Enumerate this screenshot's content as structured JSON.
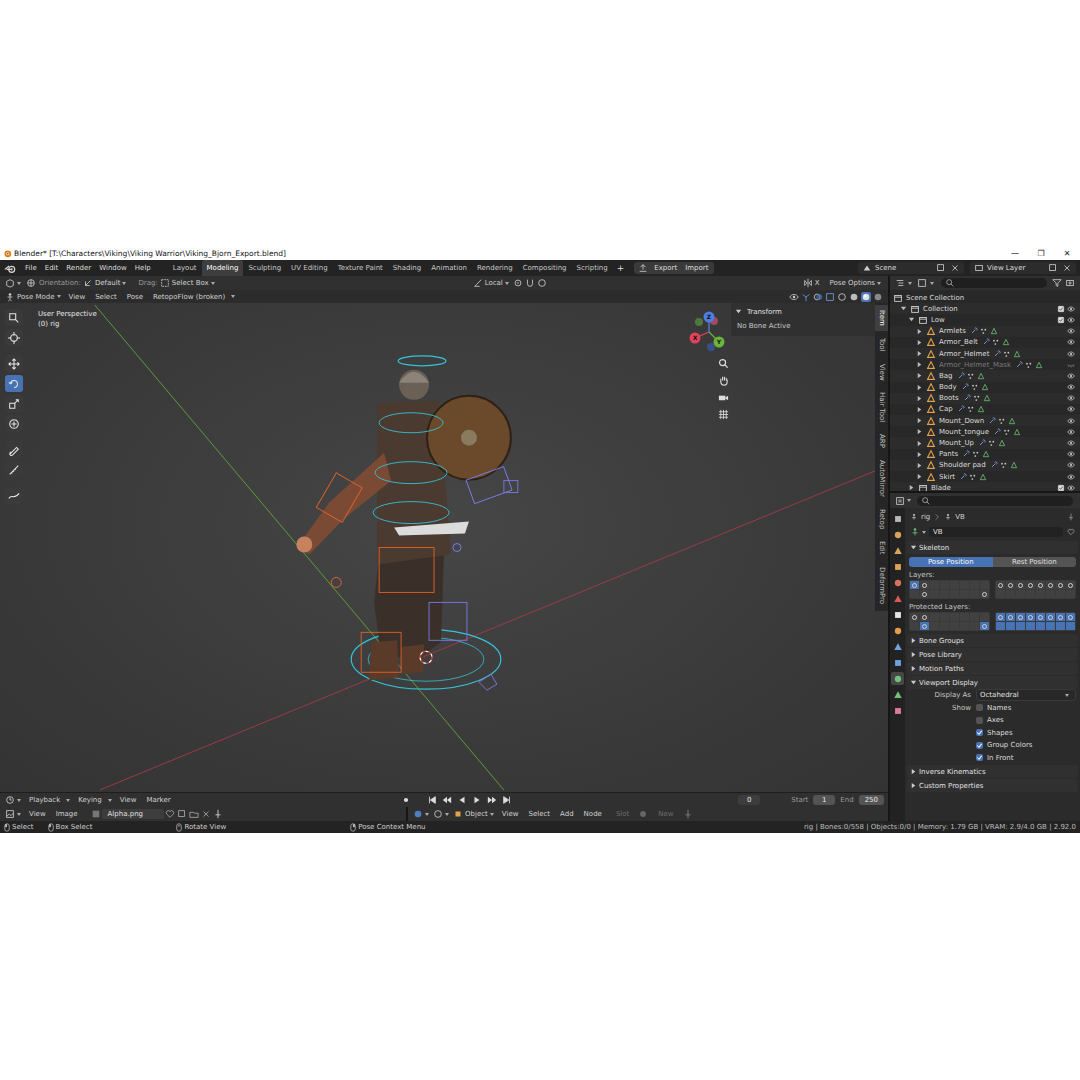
{
  "window": {
    "title": "Blender* [T:\\Characters\\Viking\\Viking Warrior\\Viking_Bjorn_Export.blend]",
    "controls": [
      "—",
      "❐",
      "✕"
    ]
  },
  "menu": [
    "File",
    "Edit",
    "Render",
    "Window",
    "Help"
  ],
  "workspaces": [
    {
      "label": "Layout",
      "selected": false
    },
    {
      "label": "Modeling",
      "selected": true
    },
    {
      "label": "Sculpting",
      "selected": false
    },
    {
      "label": "UV Editing",
      "selected": false
    },
    {
      "label": "Texture Paint",
      "selected": false
    },
    {
      "label": "Shading",
      "selected": false
    },
    {
      "label": "Animation",
      "selected": false
    },
    {
      "label": "Rendering",
      "selected": false
    },
    {
      "label": "Compositing",
      "selected": false
    },
    {
      "label": "Scripting",
      "selected": false
    }
  ],
  "workspace_add": "+",
  "addon_buttons": [
    "Export",
    "Import"
  ],
  "scene": "Scene",
  "view_layer": "View Layer",
  "viewport_header": {
    "orientation_label": "Orientation:",
    "orientation": "Default",
    "drag_label": "Drag:",
    "drag": "Select Box",
    "pivot": "Local",
    "mirror_axis": "X",
    "options": "Pose Options"
  },
  "mode_header": {
    "mode": "Pose Mode",
    "menus": [
      "View",
      "Select",
      "Pose",
      "RetopoFlow (broken)"
    ]
  },
  "viewport": {
    "view_name": "User Perspective",
    "object_name": "(0) rig",
    "gizmo_axes": [
      "X",
      "Y",
      "Z"
    ]
  },
  "tools": [
    {
      "selected": false
    },
    {
      "selected": false
    },
    {
      "selected": false
    },
    {
      "selected": true
    },
    {
      "selected": false
    },
    {
      "selected": false
    },
    {
      "selected": false
    },
    {
      "selected": false
    },
    {
      "selected": false
    }
  ],
  "sidebar": {
    "panel_title": "Transform",
    "message": "No Bone Active",
    "tabs": [
      {
        "label": "Item",
        "selected": true
      },
      {
        "label": "Tool",
        "selected": false
      },
      {
        "label": "View",
        "selected": false
      },
      {
        "label": "Hair Tool",
        "selected": false
      },
      {
        "label": "ARP",
        "selected": false
      },
      {
        "label": "AutoMirror",
        "selected": false
      },
      {
        "label": "Retop",
        "selected": false
      },
      {
        "label": "Edit",
        "selected": false
      },
      {
        "label": "DeformPro",
        "selected": false
      }
    ]
  },
  "timeline": {
    "menus": [
      "Playback",
      "Keying",
      "View",
      "Marker"
    ],
    "current_frame": "0",
    "start_label": "Start",
    "start": "1",
    "end_label": "End",
    "end": "250"
  },
  "image_editor": {
    "menus": [
      "View",
      "Image"
    ],
    "image": "Alpha.png"
  },
  "node_editor": {
    "object": "Object",
    "menus": [
      "View",
      "Select",
      "Add",
      "Node"
    ],
    "slot": "Slot",
    "new": "New"
  },
  "outliner": {
    "root": "Scene Collection",
    "collection": {
      "label": "Collection",
      "checked": true,
      "visible": true,
      "expanded": true
    },
    "sub_collections": [
      {
        "label": "Low",
        "checked": true,
        "visible": true,
        "expanded": true,
        "objects": [
          {
            "label": "Armlets",
            "visible": true
          },
          {
            "label": "Armor_Belt",
            "visible": true
          },
          {
            "label": "Armor_Helmet",
            "visible": true
          },
          {
            "label": "Armor_Helmet_Mask",
            "visible": false
          },
          {
            "label": "Bag",
            "visible": true
          },
          {
            "label": "Body",
            "visible": true
          },
          {
            "label": "Boots",
            "visible": true
          },
          {
            "label": "Cap",
            "visible": true
          },
          {
            "label": "Mount_Down",
            "visible": true
          },
          {
            "label": "Mount_tongue",
            "visible": true
          },
          {
            "label": "Mount_Up",
            "visible": true
          },
          {
            "label": "Pants",
            "visible": true
          },
          {
            "label": "Shoulder pad",
            "visible": true
          },
          {
            "label": "Skirt",
            "visible": true
          }
        ]
      },
      {
        "label": "Blade",
        "checked": true,
        "visible": true,
        "expanded": false,
        "objects": []
      }
    ]
  },
  "properties": {
    "tabs": [
      {
        "selected": false
      },
      {
        "selected": false
      },
      {
        "selected": false
      },
      {
        "selected": false
      },
      {
        "selected": false
      },
      {
        "selected": false
      },
      {
        "selected": false
      },
      {
        "selected": false
      },
      {
        "selected": false
      },
      {
        "selected": false
      },
      {
        "selected": true
      },
      {
        "selected": false
      },
      {
        "selected": false
      }
    ],
    "breadcrumb": [
      "rig",
      "VB"
    ],
    "datablock": "VB",
    "skeleton": {
      "title": "Skeleton",
      "expanded": true,
      "positions": [
        {
          "label": "Pose Position",
          "selected": true
        },
        {
          "label": "Rest Position",
          "selected": false
        }
      ],
      "layers_label": "Layers:",
      "layers": [
        {
          "on": [
            true,
            false,
            false,
            false,
            false,
            false,
            false,
            false,
            false,
            false,
            false,
            false,
            false,
            false,
            false,
            false
          ],
          "dot": [
            true,
            true,
            false,
            false,
            false,
            false,
            false,
            false,
            false,
            true,
            false,
            false,
            false,
            false,
            false,
            true
          ]
        },
        {
          "on": [
            false,
            false,
            false,
            false,
            false,
            false,
            false,
            false,
            false,
            false,
            false,
            false,
            false,
            false,
            false,
            false
          ],
          "dot": [
            true,
            true,
            true,
            true,
            true,
            true,
            true,
            true,
            false,
            false,
            false,
            false,
            false,
            false,
            false,
            false
          ]
        }
      ],
      "protected_label": "Protected Layers:",
      "protected": [
        {
          "on": [
            false,
            false,
            false,
            false,
            false,
            false,
            false,
            false,
            false,
            true,
            false,
            false,
            false,
            false,
            false,
            true
          ],
          "dot": [
            true,
            true,
            false,
            false,
            false,
            false,
            false,
            false,
            false,
            true,
            false,
            false,
            false,
            false,
            false,
            true
          ]
        },
        {
          "on": [
            true,
            true,
            true,
            true,
            true,
            true,
            true,
            true,
            true,
            true,
            true,
            true,
            true,
            true,
            true,
            true
          ],
          "dot": [
            true,
            true,
            true,
            true,
            true,
            true,
            true,
            true,
            false,
            false,
            false,
            false,
            false,
            false,
            false,
            false
          ]
        }
      ]
    },
    "collapsed_panels": [
      {
        "title": "Bone Groups",
        "expanded": false
      },
      {
        "title": "Pose Library",
        "expanded": false
      },
      {
        "title": "Motion Paths",
        "expanded": false
      }
    ],
    "viewport_display": {
      "title": "Viewport Display",
      "expanded": true,
      "display_as_label": "Display As",
      "display_as": "Octahedral",
      "show_label": "Show",
      "options": [
        {
          "label": "Names",
          "checked": false
        },
        {
          "label": "Axes",
          "checked": false
        },
        {
          "label": "Shapes",
          "checked": true
        },
        {
          "label": "Group Colors",
          "checked": true
        },
        {
          "label": "In Front",
          "checked": true
        }
      ]
    },
    "more_panels": [
      {
        "title": "Inverse Kinematics",
        "expanded": false
      },
      {
        "title": "Custom Properties",
        "expanded": false
      }
    ]
  },
  "status_bar": {
    "hints": [
      "Select",
      "Box Select",
      "Rotate View",
      "Pose Context Menu"
    ],
    "info": "rig | Bones:0/558 | Objects:0/0 | Memory: 1.79 GB | VRAM: 2.9/4.0 GB | 2.92.0"
  }
}
